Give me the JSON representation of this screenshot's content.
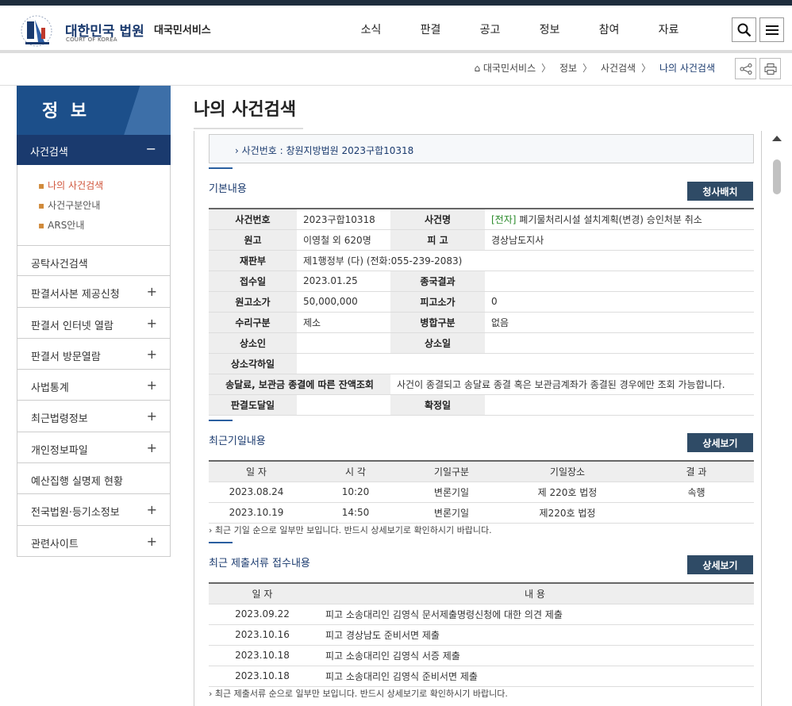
{
  "header": {
    "logo_title": "대한민국 법원",
    "logo_sub": "COURT OF KOREA",
    "service": "대국민서비스",
    "nav": [
      "소식",
      "판결",
      "공고",
      "정보",
      "참여",
      "자료"
    ]
  },
  "breadcrumb": [
    "대국민서비스",
    "정보",
    "사건검색",
    "나의 사건검색"
  ],
  "sidebar": {
    "title": "정 보",
    "active": "사건검색",
    "active_mark": "−",
    "subitems": [
      "나의 사건검색",
      "사건구분안내",
      "ARS안내"
    ],
    "items": [
      {
        "label": "공탁사건검색",
        "mark": ""
      },
      {
        "label": "판결서사본 제공신청",
        "mark": "+"
      },
      {
        "label": "판결서 인터넷 열람",
        "mark": "+"
      },
      {
        "label": "판결서 방문열람",
        "mark": "+"
      },
      {
        "label": "사법통계",
        "mark": "+"
      },
      {
        "label": "최근법령정보",
        "mark": "+"
      },
      {
        "label": "개인정보파일",
        "mark": "+"
      },
      {
        "label": "예산집행 실명제 현황",
        "mark": ""
      },
      {
        "label": "전국법원·등기소정보",
        "mark": "+"
      },
      {
        "label": "관련사이트",
        "mark": "+"
      }
    ]
  },
  "page_title": "나의 사건검색",
  "case_number_line": "사건번호 : 창원지방법원 2023구합10318",
  "basic": {
    "title": "기본내용",
    "button": "청사배치",
    "rows": [
      [
        "사건번호",
        "2023구합10318",
        "사건명",
        ""
      ],
      [
        "원고",
        "이영철 외 620명",
        "피 고",
        "경상남도지사"
      ],
      [
        "재판부",
        "제1행정부 (다) (전화:055-239-2083)",
        "",
        ""
      ],
      [
        "접수일",
        "2023.01.25",
        "종국결과",
        ""
      ],
      [
        "원고소가",
        "50,000,000",
        "피고소가",
        "0"
      ],
      [
        "수리구분",
        "제소",
        "병합구분",
        "없음"
      ],
      [
        "상소인",
        "",
        "상소일",
        ""
      ],
      [
        "상소각하일",
        "",
        "",
        ""
      ],
      [
        "송달료, 보관금 종결에 따른 잔액조회",
        "사건이 종결되고 송달료 종결 혹은 보관금계좌가 종결된 경우에만 조회 가능합니다.",
        "",
        ""
      ],
      [
        "판결도달일",
        "",
        "확정일",
        ""
      ]
    ],
    "case_name_tag": "[전자]",
    "case_name": "폐기물처리시설 설치계획(변경) 승인처분 취소"
  },
  "hearings": {
    "title": "최근기일내용",
    "button": "상세보기",
    "headers": [
      "일 자",
      "시 각",
      "기일구분",
      "기일장소",
      "결 과"
    ],
    "rows": [
      [
        "2023.08.24",
        "10:20",
        "변론기일",
        "제 220호 법정",
        "속행"
      ],
      [
        "2023.10.19",
        "14:50",
        "변론기일",
        "제220호 법정",
        ""
      ]
    ],
    "note": "최근 기일 순으로 일부만 보입니다. 반드시 상세보기로 확인하시기 바랍니다."
  },
  "documents": {
    "title": "최근 제출서류 접수내용",
    "button": "상세보기",
    "headers": [
      "일 자",
      "내 용"
    ],
    "rows": [
      [
        "2023.09.22",
        "피고 소송대리인 김영식 문서제출명령신청에 대한 의견 제출"
      ],
      [
        "2023.10.16",
        "피고 경상남도 준비서면 제출"
      ],
      [
        "2023.10.18",
        "피고 소송대리인 김영식 서증 제출"
      ],
      [
        "2023.10.18",
        "피고 소송대리인 김영식 준비서면 제출"
      ]
    ],
    "note": "최근 제출서류 순으로 일부만 보입니다. 반드시 상세보기로 확인하시기 바랍니다."
  }
}
